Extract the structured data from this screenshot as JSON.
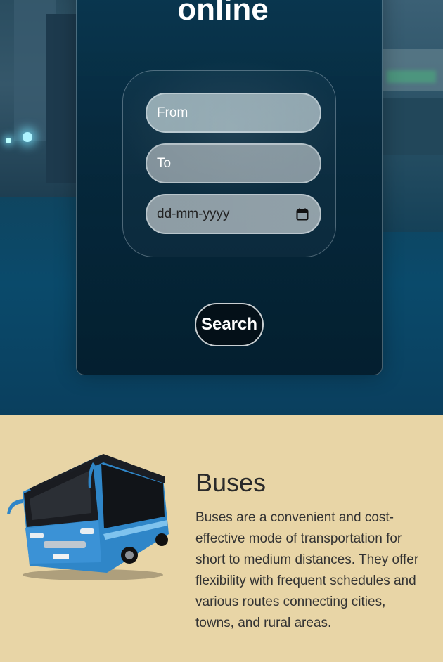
{
  "hero": {
    "heading": "online",
    "from_placeholder": "From",
    "to_placeholder": "To",
    "date_placeholder": "dd-mm-yyyy",
    "search_label": "Search"
  },
  "buses": {
    "title": "Buses",
    "description": "Buses are a convenient and cost-effective mode of transportation for short to medium distances. They offer flexibility with frequent schedules and various routes connecting cities, towns, and rural areas."
  },
  "colors": {
    "accent": "#e8d5a6",
    "button_bg": "#041018"
  },
  "icons": {
    "date": "calendar-icon"
  }
}
